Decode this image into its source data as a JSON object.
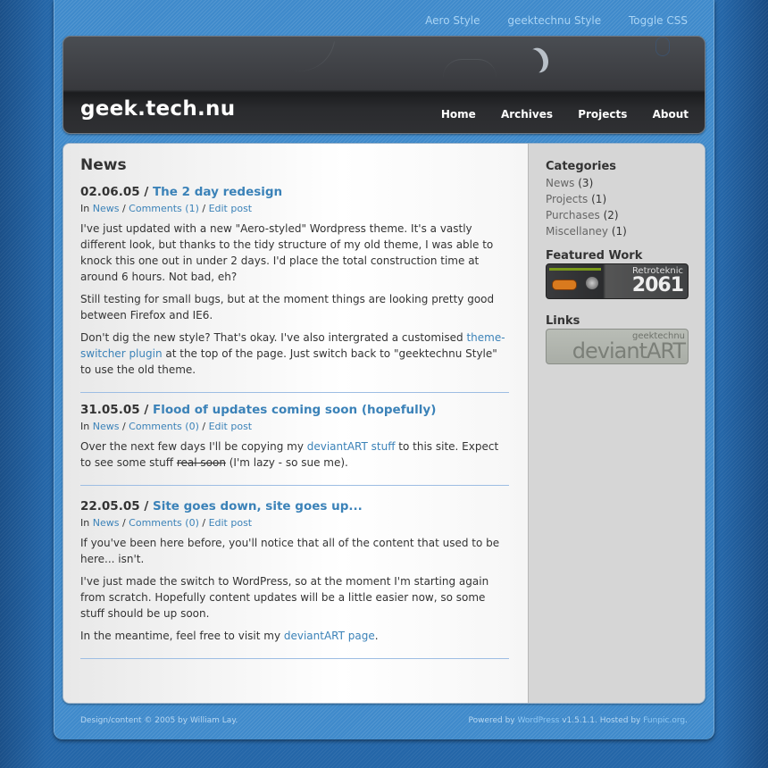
{
  "style_switcher": {
    "links": [
      "Aero Style",
      "geektechnu Style",
      "Toggle CSS"
    ]
  },
  "header": {
    "site_title": "geek.tech.nu",
    "nav": [
      "Home",
      "Archives",
      "Projects",
      "About"
    ]
  },
  "main": {
    "heading": "News",
    "posts": [
      {
        "date": "02.06.05",
        "separator": " / ",
        "title": "The 2 day redesign",
        "meta": {
          "in": "In ",
          "category": "News",
          "sep": " / ",
          "comments": "Comments (1)",
          "edit": "Edit post"
        },
        "paragraphs": [
          {
            "text": "I've just updated with a new \"Aero-styled\" Wordpress theme. It's a vastly different look, but thanks to the tidy structure of my old theme, I was able to knock this one out in under 2 days. I'd place the total construction time at around 6 hours. Not bad, eh?"
          },
          {
            "text": "Still testing for small bugs, but at the moment things are looking pretty good between Firefox and IE6."
          },
          {
            "before": "Don't dig the new style? That's okay. I've also intergrated a customised ",
            "link": "theme-switcher plugin",
            "after": " at the top of the page. Just switch back to \"geektechnu Style\" to use the old theme."
          }
        ]
      },
      {
        "date": "31.05.05",
        "separator": " / ",
        "title": "Flood of updates coming soon (hopefully)",
        "meta": {
          "in": "In ",
          "category": "News",
          "sep": " / ",
          "comments": "Comments (0)",
          "edit": "Edit post"
        },
        "paragraphs": [
          {
            "before": "Over the next few days I'll be copying my ",
            "link": "deviantART stuff",
            "middle": " to this site. Expect to see some stuff ",
            "strike": "real soon",
            "after": " (I'm lazy - so sue me)."
          }
        ]
      },
      {
        "date": "22.05.05",
        "separator": " / ",
        "title": "Site goes down, site goes up...",
        "meta": {
          "in": "In ",
          "category": "News",
          "sep": " / ",
          "comments": "Comments (0)",
          "edit": "Edit post"
        },
        "paragraphs": [
          {
            "text": "If you've been here before, you'll notice that all of the content that used to be here... isn't."
          },
          {
            "text": "I've just made the switch to WordPress, so at the moment I'm starting again from scratch. Hopefully content updates will be a little easier now, so some stuff should be up soon."
          },
          {
            "before": "In the meantime, feel free to visit my ",
            "link": "deviantART page",
            "after": "."
          }
        ]
      }
    ]
  },
  "sidebar": {
    "categories_title": "Categories",
    "categories": [
      {
        "name": "News",
        "count": " (3)"
      },
      {
        "name": "Projects",
        "count": " (1)"
      },
      {
        "name": "Purchases",
        "count": " (2)"
      },
      {
        "name": "Miscellaney",
        "count": " (1)"
      }
    ],
    "featured_title": "Featured Work",
    "featured_badge": {
      "line1": "Retroteknic",
      "line2": "2061"
    },
    "links_title": "Links",
    "links_badge": {
      "line1": "geektechnu",
      "line2": "deviantART"
    }
  },
  "footer": {
    "left": "Design/content © 2005 by William Lay.",
    "right_prefix": "Powered by ",
    "wordpress": "WordPress",
    "version": " v1.5.1.1. Hosted by ",
    "host": "Funpic.org",
    "end": "."
  }
}
